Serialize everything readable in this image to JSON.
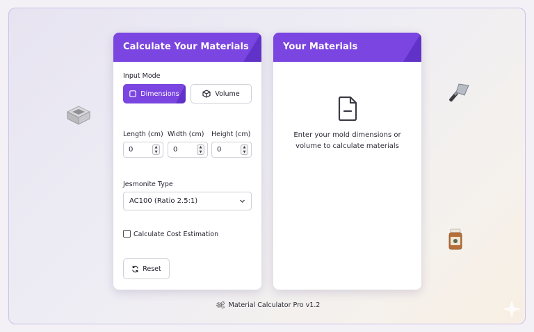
{
  "left_card": {
    "title": "Calculate Your Materials",
    "input_mode_label": "Input Mode",
    "mode_dimensions": "Dimensions",
    "mode_volume": "Volume",
    "length_label": "Length (cm)",
    "width_label": "Width (cm)",
    "height_label": "Height (cm)",
    "length_value": "0",
    "width_value": "0",
    "height_value": "0",
    "type_label": "Jesmonite Type",
    "type_selected": "AC100 (Ratio 2.5:1)",
    "cost_label": "Calculate Cost Estimation",
    "reset_label": "Reset"
  },
  "right_card": {
    "title": "Your Materials",
    "empty_line1": "Enter your mold dimensions or",
    "empty_line2": "volume to calculate materials"
  },
  "footer": {
    "text": "Material Calculator Pro v1.2"
  },
  "colors": {
    "accent": "#7a45e0",
    "accent_dark": "#5a2cc0"
  }
}
